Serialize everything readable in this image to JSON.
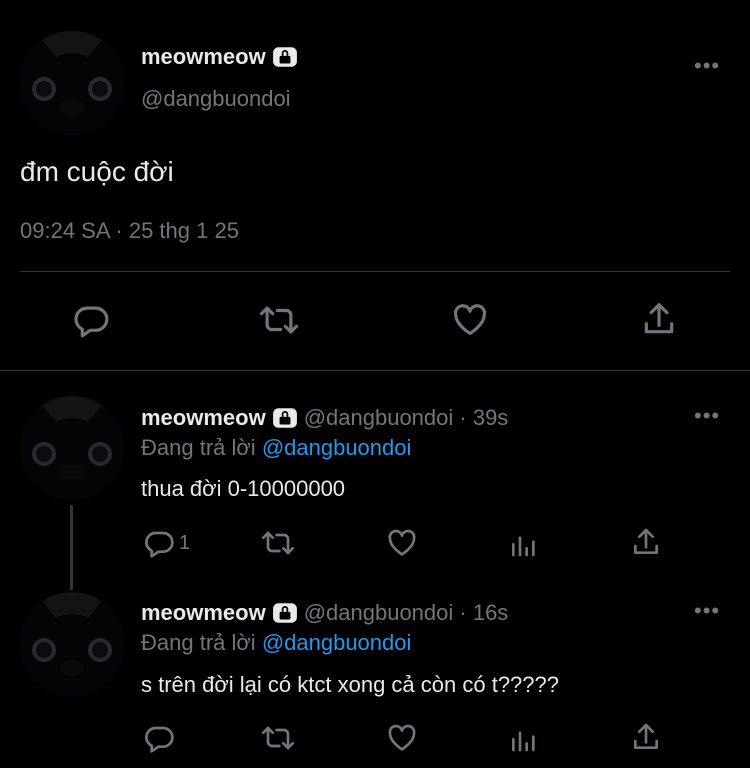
{
  "main_tweet": {
    "display_name": "meowmeow",
    "handle": "@dangbuondoi",
    "text": "đm cuộc đời",
    "timestamp": "09:24 SA · 25 thg 1 25",
    "more": "•••"
  },
  "replies": [
    {
      "display_name": "meowmeow",
      "handle_time": "@dangbuondoi · 39s",
      "replying_prefix": "Đang trả lời ",
      "replying_to": "@dangbuondoi",
      "text": "thua đời 0-10000000",
      "reply_count": "1",
      "more": "•••"
    },
    {
      "display_name": "meowmeow",
      "handle_time": "@dangbuondoi · 16s",
      "replying_prefix": "Đang trả lời ",
      "replying_to": "@dangbuondoi",
      "text": "s trên đời lại có ktct xong cả còn có t?????",
      "reply_count": "",
      "more": "•••"
    }
  ],
  "icons": {
    "reply": "reply-icon",
    "retweet": "retweet-icon",
    "like": "heart-icon",
    "views": "views-icon",
    "share": "share-icon",
    "lock": "lock-icon"
  },
  "colors": {
    "background": "#000000",
    "text": "#e7e9ea",
    "muted": "#71767b",
    "link": "#1d9bf0",
    "divider": "#2f3336"
  }
}
